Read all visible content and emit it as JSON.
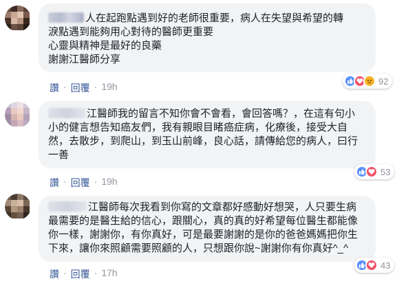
{
  "comments": [
    {
      "lines": [
        "人在起跑點遇到好的老師很重要，病人在失望與希望的轉",
        "淚點遇到能夠用心對待的醫師更重要",
        "心靈與精神是最好的良藥",
        "謝謝江醫師分享"
      ],
      "like_label": "讚",
      "reply_label": "回覆",
      "time": "19h",
      "reaction_count": "92",
      "reaction_icons": [
        "like-icon",
        "love-icon",
        "sad-icon"
      ]
    },
    {
      "lines": [
        "江醫師我的留言不知你會不會看，會回答嗎？，在這有句小",
        "小的健言想告知癌友們，我有親眼目睹癌症病，化療後，接受大自",
        "然，去散步，到爬山，到玉山前峰，良心話，請傳給您的病人，曰行",
        "一善"
      ],
      "like_label": "讚",
      "reply_label": "回覆",
      "time": "19h",
      "reaction_count": "53",
      "reaction_icons": [
        "like-icon",
        "love-icon"
      ]
    },
    {
      "lines": [
        "江醫師每次我看到你寫的文章都好感動好想哭，人只要生病",
        "最需要的是醫生給的信心，跟關心，真的真的好希望每位醫生都能像",
        "你一樣，謝謝你，有你真好，可是最要謝謝的是你的爸爸媽媽把你生",
        "下來，讓你來照顧需要照顧的人，只想跟你說~謝謝你有你真好^_^"
      ],
      "like_label": "讚",
      "reply_label": "回覆",
      "time": "17h",
      "reaction_count": "43",
      "reaction_icons": [
        "like-icon",
        "love-icon"
      ]
    }
  ],
  "colors": {
    "link": "#385898",
    "bubble": "#f2f3f5",
    "like": "#5890ff",
    "love": "#f25268",
    "sad": "#f7b125"
  }
}
